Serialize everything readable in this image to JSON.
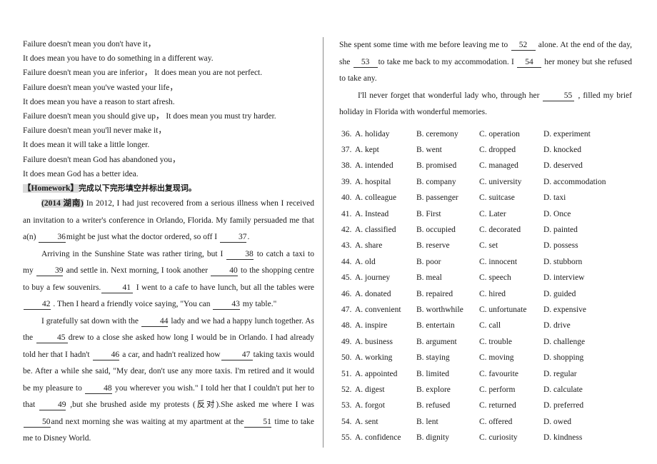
{
  "document": {
    "quote_lines": [
      "Failure doesn't mean you don't have it，",
      "It does mean you have to do something in a different way.",
      "Failure doesn't mean you are inferior，  It does mean you are not perfect.",
      "Failure doesn't mean you've wasted your life，",
      "It does mean you have a reason to start afresh.",
      "Failure doesn't mean you should give up，  It does mean you must try harder.",
      "Failure doesn't mean you'll never make it，",
      "It does mean it will take a little longer.",
      "Failure doesn't mean God has abandoned you，",
      "It does mean God has a better idea."
    ],
    "homework": {
      "tag": "【Homework】",
      "instruction": "完成以下完形填空并标出复现词。"
    },
    "passage": {
      "source_tag": "(2014 湖南)",
      "p1_a": "In 2012, I had just recovered from a serious illness when I received an invitation to a writer's conference in Orlando, Florida. My family persuaded me that a(n)",
      "p1_blank1": "36",
      "p1_b": "might be just what the doctor ordered, so off I",
      "p1_blank2": "37",
      "p1_c": ".",
      "p2_a": "Arriving in the Sunshine State was rather tiring, but I",
      "p2_blank1": "38",
      "p2_b": "to catch a taxi to my",
      "p2_blank2": "39",
      "p2_c": "and settle in. Next morning, I took another",
      "p2_blank3": "40",
      "p2_d": "to the shopping centre to buy a few souvenirs.",
      "p2_blank4": "41",
      "p2_e": "I went to a cafe to have lunch, but all the tables were",
      "p2_blank5": "42",
      "p2_f": ". Then I heard a friendly voice saying, \"You can",
      "p2_blank6": "43",
      "p2_g": "my table.\"",
      "p3_a": "I gratefully sat down with the",
      "p3_blank1": "44",
      "p3_b": "lady and we had a happy lunch together. As the",
      "p3_blank2": "45",
      "p3_c": "drew to a close she asked how long I would be in Orlando. I had already told her that I hadn't",
      "p3_blank3": "46",
      "p3_d": "a car, and hadn't realized how",
      "p3_blank4": "47",
      "p3_e": "taking taxis would be. After a while she said, \"My dear, don't use any more taxis. I'm retired and it would be my pleasure to",
      "p3_blank5": "48",
      "p3_f": "you wherever you wish.\" I told her that I couldn't put her to that",
      "p3_blank6": "49",
      "p3_g": ",but she brushed aside my protests (反对).She asked me where I was",
      "p3_blank7": "50",
      "p3_h": "and next morning she was waiting at my apartment at the",
      "p3_blank8": "51",
      "p3_i": "time to take me to Disney World.",
      "p4_a": "She spent some time with me before leaving me to",
      "p4_blank1": "52",
      "p4_b": "alone. At the end of the day, she",
      "p4_blank2": "53",
      "p4_c": "to take me back to my accommodation. I",
      "p4_blank3": "54",
      "p4_d": "her money but she refused to take any.",
      "p5_a": "I'll never forget that wonderful lady who, through her",
      "p5_blank1": "55",
      "p5_b": ", filled my brief holiday in Florida with wonderful memories."
    },
    "options": [
      {
        "num": "36.",
        "a": "A. holiday",
        "b": "B. ceremony",
        "c": "C. operation",
        "d": "D. experiment"
      },
      {
        "num": "37.",
        "a": "A. kept",
        "b": "B. went",
        "c": "C. dropped",
        "d": "D. knocked"
      },
      {
        "num": "38.",
        "a": "A. intended",
        "b": "B. promised",
        "c": "C. managed",
        "d": "D. deserved"
      },
      {
        "num": "39.",
        "a": "A. hospital",
        "b": "B. company",
        "c": "C. university",
        "d": "D. accommodation"
      },
      {
        "num": "40.",
        "a": "A. colleague",
        "b": "B. passenger",
        "c": "C. suitcase",
        "d": "D. taxi"
      },
      {
        "num": "41.",
        "a": "A. Instead",
        "b": "B. First",
        "c": "C. Later",
        "d": "D. Once"
      },
      {
        "num": "42.",
        "a": "A. classified",
        "b": "B. occupied",
        "c": "C. decorated",
        "d": "D. painted"
      },
      {
        "num": "43.",
        "a": "A. share",
        "b": "B. reserve",
        "c": "C. set",
        "d": "D. possess"
      },
      {
        "num": "44.",
        "a": "A. old",
        "b": "B. poor",
        "c": "C. innocent",
        "d": "D. stubborn"
      },
      {
        "num": "45.",
        "a": "A. journey",
        "b": "B. meal",
        "c": "C. speech",
        "d": "D. interview"
      },
      {
        "num": "46.",
        "a": "A. donated",
        "b": "B. repaired",
        "c": "C. hired",
        "d": "D. guided"
      },
      {
        "num": "47.",
        "a": "A. convenient",
        "b": "B. worthwhile",
        "c": "C. unfortunate",
        "d": "D. expensive"
      },
      {
        "num": "48.",
        "a": "A. inspire",
        "b": "B. entertain",
        "c": "C. call",
        "d": "D. drive"
      },
      {
        "num": "49.",
        "a": "A. business",
        "b": "B. argument",
        "c": "C. trouble",
        "d": "D. challenge"
      },
      {
        "num": "50.",
        "a": "A. working",
        "b": "B. staying",
        "c": "C. moving",
        "d": "D. shopping"
      },
      {
        "num": "51.",
        "a": "A. appointed",
        "b": "B. limited",
        "c": "C. favourite",
        "d": "D. regular"
      },
      {
        "num": "52.",
        "a": "A. digest",
        "b": "B. explore",
        "c": "C. perform",
        "d": "D. calculate"
      },
      {
        "num": "53.",
        "a": "A. forgot",
        "b": "B. refused",
        "c": "C. returned",
        "d": "D. preferred"
      },
      {
        "num": "54.",
        "a": "A. sent",
        "b": "B. lent",
        "c": "C. offered",
        "d": "D. owed"
      },
      {
        "num": "55.",
        "a": "A. confidence",
        "b": "B. dignity",
        "c": "C. curiosity",
        "d": "D. kindness"
      }
    ]
  }
}
